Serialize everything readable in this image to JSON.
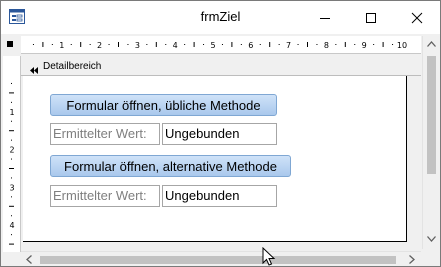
{
  "window": {
    "title": "frmZiel"
  },
  "icons": {
    "app": "form-icon",
    "minimize": "minimize-icon",
    "maximize": "maximize-icon",
    "close": "close-icon",
    "section": "section-collapse-icon",
    "cursor": "mouse-pointer-icon"
  },
  "ruler": {
    "horizontal": [
      "1",
      "2",
      "3",
      "4",
      "5",
      "6",
      "7",
      "8",
      "9",
      "10"
    ],
    "vertical": [
      "1",
      "2",
      "3",
      "4"
    ]
  },
  "section": {
    "label": "Detailbereich"
  },
  "form": {
    "button1": "Formular öffnen, übliche Methode",
    "label1": "Ermittelter Wert:",
    "value1": "Ungebunden",
    "button2": "Formular öffnen, alternative Methode",
    "label2": "Ermittelter Wert:",
    "value2": "Ungebunden"
  },
  "colors": {
    "button_fill": "#b8d2f1",
    "button_border": "#7fa7d3",
    "label_text": "#7f7f7f"
  }
}
